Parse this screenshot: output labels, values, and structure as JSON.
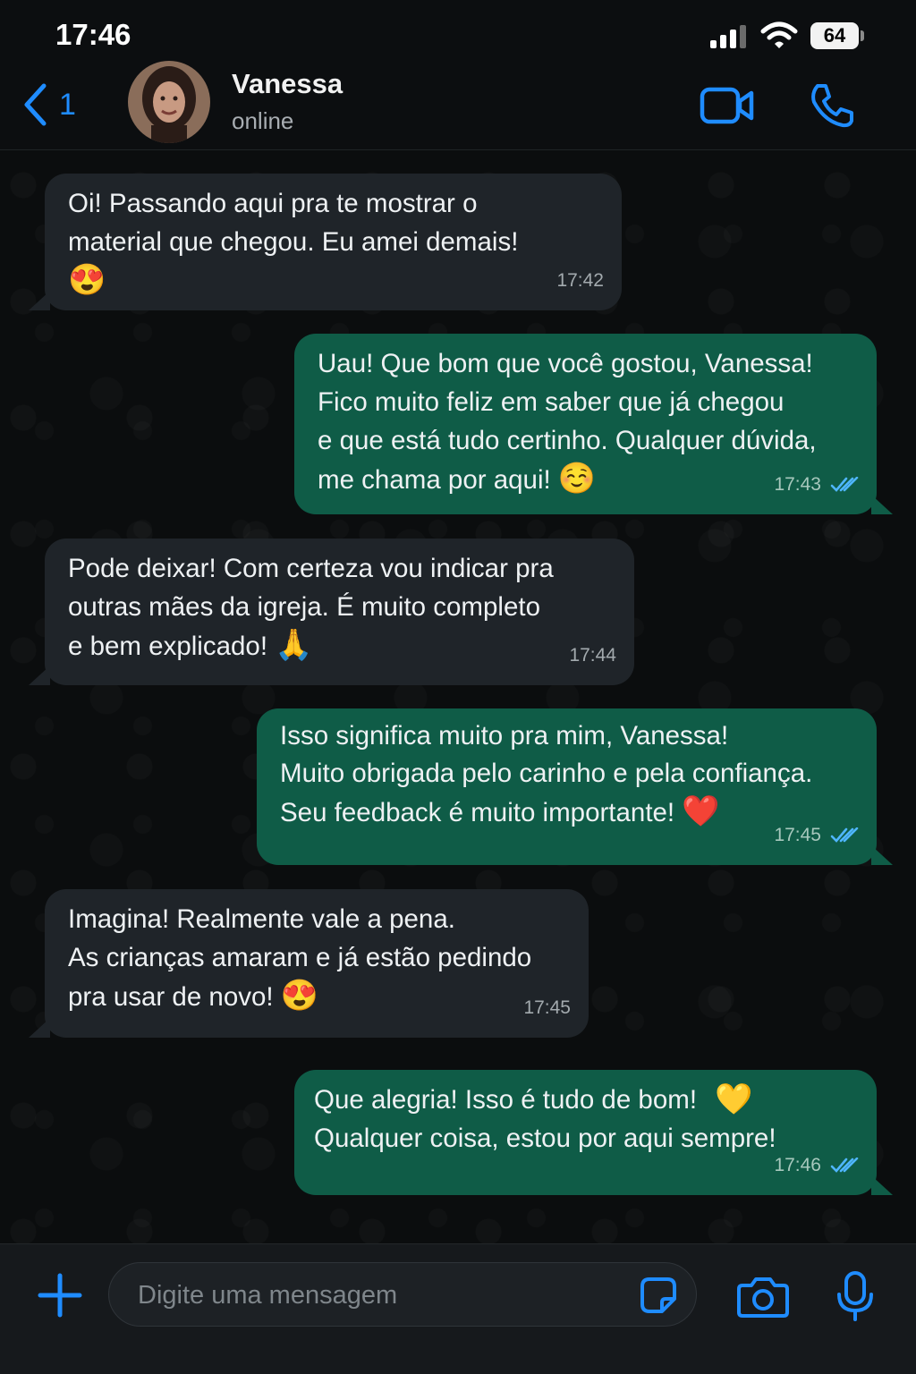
{
  "status_bar": {
    "time": "17:46",
    "battery": "64"
  },
  "header": {
    "back_count": "1",
    "contact_name": "Vanessa",
    "contact_status": "online"
  },
  "colors": {
    "accent": "#1f8cff",
    "incoming_bubble": "#1f2429",
    "outgoing_bubble": "#0f5c47",
    "read_ticks": "#4fb6ff"
  },
  "messages": [
    {
      "direction": "incoming",
      "text": "Oi! Passando aqui pra te mostrar o\nmaterial que chegou. Eu amei demais!",
      "emoji": "😍",
      "time": "17:42"
    },
    {
      "direction": "outgoing",
      "text": "Uau! Que bom que você gostou, Vanessa!\nFico muito feliz em saber que já chegou\ne que está tudo certinho. Qualquer dúvida,\nme chama por aqui!",
      "emoji": "☺️",
      "time": "17:43",
      "status_icon": "double-check-read-icon"
    },
    {
      "direction": "incoming",
      "text": "Pode deixar! Com certeza vou indicar pra\noutras mães da igreja. É muito completo\ne bem explicado!",
      "emoji": "🙏",
      "time": "17:44"
    },
    {
      "direction": "outgoing",
      "text": "Isso significa muito pra mim, Vanessa!\nMuito obrigada pelo carinho e pela confiança.\nSeu feedback é muito importante!",
      "emoji": "❤️",
      "time": "17:45",
      "status_icon": "double-check-read-icon"
    },
    {
      "direction": "incoming",
      "text": "Imagina! Realmente vale a pena.\nAs crianças amaram e já estão pedindo\npra usar de novo!",
      "emoji": "😍",
      "time": "17:45"
    },
    {
      "direction": "outgoing",
      "text": "Que alegria! Isso é tudo de bom!\nQualquer coisa, estou por aqui sempre!",
      "emoji": "💛",
      "time": "17:46",
      "status_icon": "double-check-read-icon"
    }
  ],
  "composer": {
    "placeholder": "Digite uma mensagem"
  }
}
